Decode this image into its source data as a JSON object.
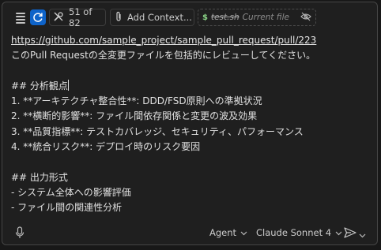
{
  "toolbar": {
    "tools_count": "51 of 82",
    "add_context_label": "Add Context...",
    "file_name": "test.sh",
    "file_hint": "Current file"
  },
  "editor": {
    "lines": [
      "https://github.com/sample_project/sample_pull_request/pull/223",
      "このPull Requestの全変更ファイルを包括的にレビューしてください。",
      "",
      "## 分析観点",
      "1. **アーキテクチャ整合性**: DDD/FSD原則への準拠状況",
      "2. **横断的影響**: ファイル間依存関係と変更の波及効果",
      "3. **品質指標**: テストカバレッジ、セキュリティ、パフォーマンス",
      "4. **統合リスク**: デプロイ時のリスク要因",
      "",
      "## 出力形式",
      "- システム全体への影響評価",
      "- ファイル間の関連性分析"
    ]
  },
  "footer": {
    "mode_label": "Agent",
    "model_label": "Claude Sonnet 4"
  },
  "colors": {
    "panel_bg": "#1f1f1f",
    "accent": "#0e63c9",
    "text": "#e0e0e0"
  }
}
